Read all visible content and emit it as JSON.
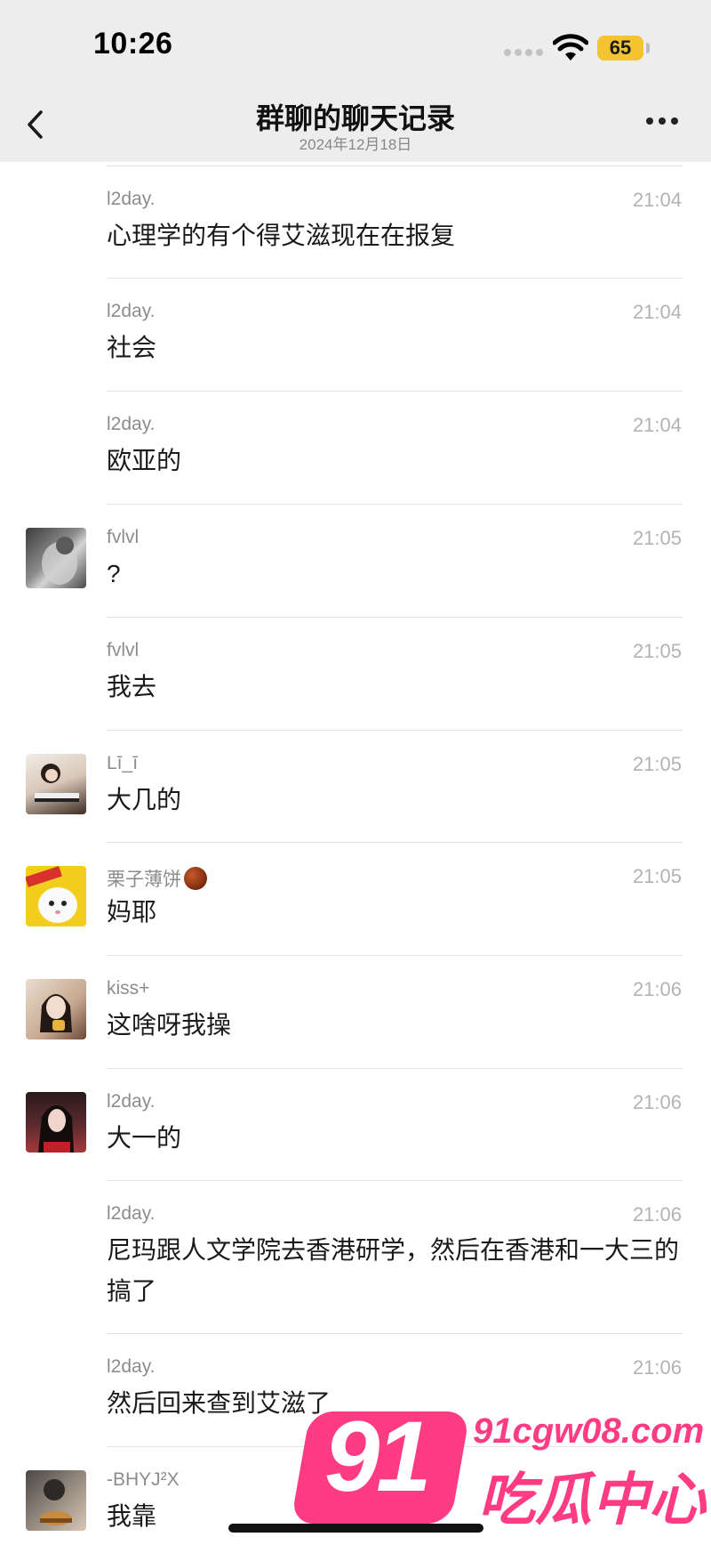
{
  "status_bar": {
    "time": "10:26",
    "battery": "65"
  },
  "header": {
    "title": "群聊的聊天记录",
    "date": "2024年12月18日"
  },
  "messages": [
    {
      "name": "l2day.",
      "time": "21:04",
      "text": "心理学的有个得艾滋现在在报复"
    },
    {
      "name": "l2day.",
      "time": "21:04",
      "text": "社会"
    },
    {
      "name": "l2day.",
      "time": "21:04",
      "text": "欧亚的"
    },
    {
      "name": "fvlvl",
      "time": "21:05",
      "text": "?"
    },
    {
      "name": "fvlvl",
      "time": "21:05",
      "text": "我去"
    },
    {
      "name": "Lī_ī",
      "time": "21:05",
      "text": "大几的"
    },
    {
      "name": "栗子薄饼",
      "time": "21:05",
      "text": "妈耶"
    },
    {
      "name": "kiss+",
      "time": "21:06",
      "text": "这啥呀我操"
    },
    {
      "name": "l2day.",
      "time": "21:06",
      "text": "大一的"
    },
    {
      "name": "l2day.",
      "time": "21:06",
      "text": "尼玛跟人文学院去香港研学，然后在香港和一大三的搞了"
    },
    {
      "name": "l2day.",
      "time": "21:06",
      "text": "然后回来查到艾滋了"
    },
    {
      "name": "-BHYJ²X",
      "time": "",
      "text": "我靠"
    }
  ],
  "watermark": {
    "number": "91",
    "url": "91cgw08.com",
    "brand": "吃瓜中心"
  }
}
